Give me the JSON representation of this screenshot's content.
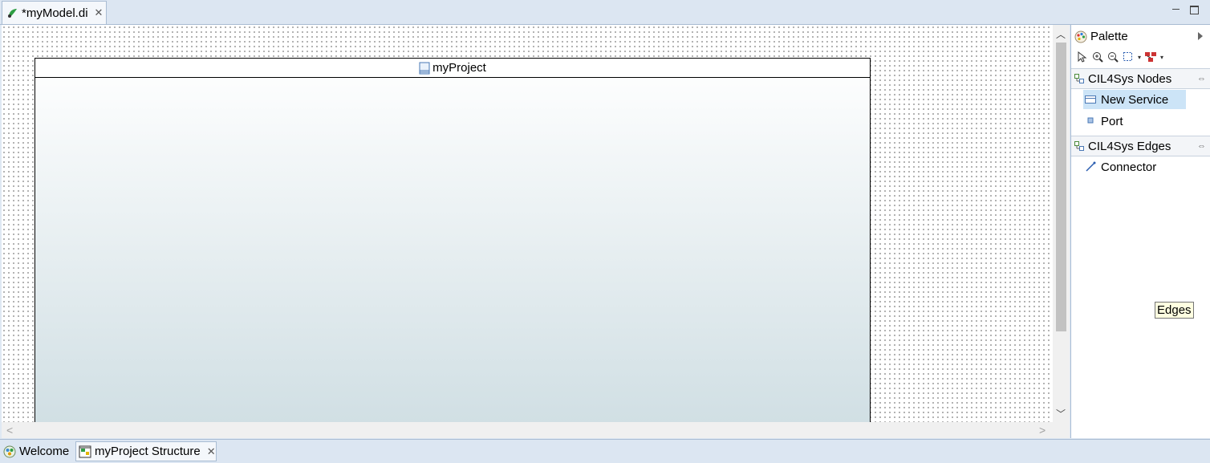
{
  "editor_tab": {
    "title": "*myModel.di",
    "close": "✕"
  },
  "diagram": {
    "container_name": "myProject"
  },
  "palette": {
    "title": "Palette",
    "drawers": [
      {
        "label": "CIL4Sys Nodes",
        "entries": [
          {
            "label": "New Service"
          },
          {
            "label": "Port"
          }
        ]
      },
      {
        "label": "CIL4Sys Edges",
        "entries": [
          {
            "label": "Connector"
          }
        ]
      }
    ],
    "tooltip": "Edges"
  },
  "bottom_tabs": [
    {
      "label": "Welcome"
    },
    {
      "label": "myProject Structure",
      "close": "✕"
    }
  ],
  "colors": {
    "selection": "#cce4f7",
    "tab_bar": "#dce6f2",
    "accent_icon": "#2e9e44"
  }
}
